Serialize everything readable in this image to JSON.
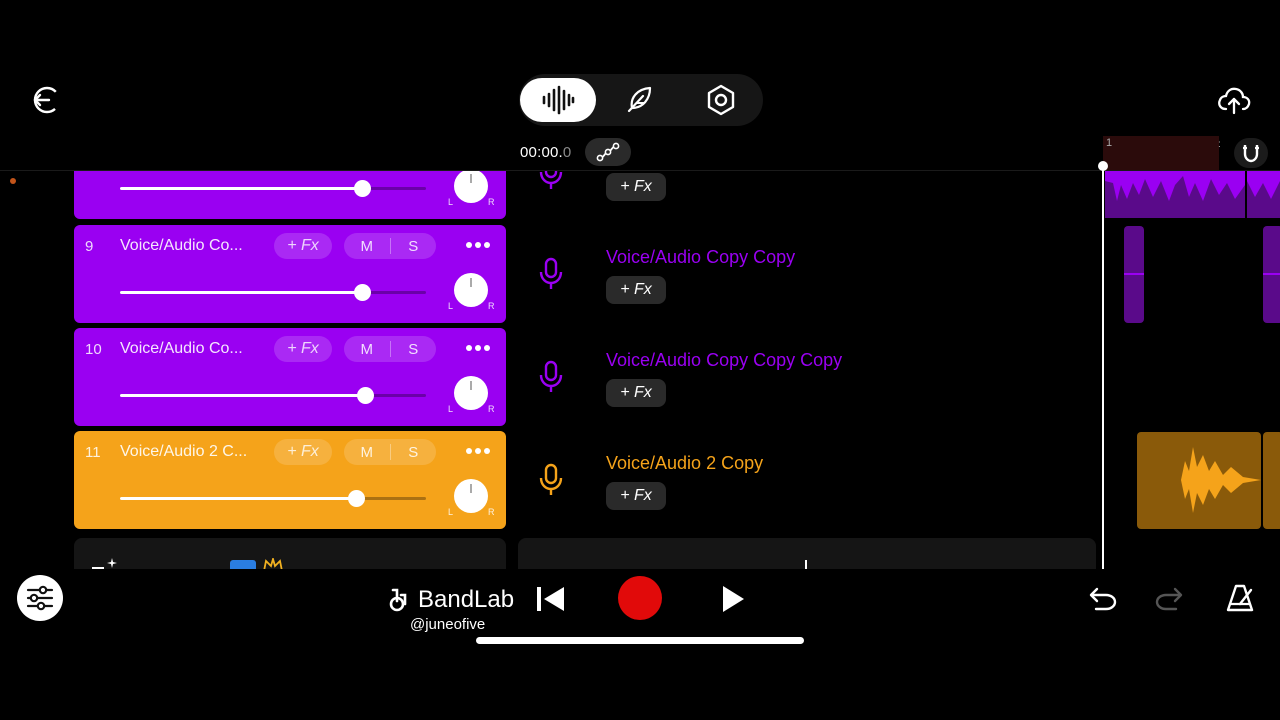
{
  "toolbar": {
    "time_main": "00:00.",
    "time_fraction": "0"
  },
  "ruler": {
    "bar_number": "1"
  },
  "tracks": [
    {
      "num": "",
      "name": "",
      "fx": "+ Fx",
      "mute": "M",
      "solo": "S",
      "volume": 0.79,
      "color": "#9a00f2",
      "pan_l": "L",
      "pan_r": "R",
      "title": "",
      "title_color": "#9a00f2"
    },
    {
      "num": "9",
      "name": "Voice/Audio Co...",
      "fx": "+ Fx",
      "mute": "M",
      "solo": "S",
      "volume": 0.79,
      "color": "#9a00f2",
      "pan_l": "L",
      "pan_r": "R",
      "title": "Voice/Audio Copy Copy",
      "title_color": "#9a00f2"
    },
    {
      "num": "10",
      "name": "Voice/Audio Co...",
      "fx": "+ Fx",
      "mute": "M",
      "solo": "S",
      "volume": 0.8,
      "color": "#9a00f2",
      "pan_l": "L",
      "pan_r": "R",
      "title": "Voice/Audio Copy Copy Copy",
      "title_color": "#9a00f2"
    },
    {
      "num": "11",
      "name": "Voice/Audio 2 C...",
      "fx": "+ Fx",
      "mute": "M",
      "solo": "S",
      "volume": 0.77,
      "color": "#f5a31a",
      "pan_l": "L",
      "pan_r": "R",
      "title": "Voice/Audio 2 Copy",
      "title_color": "#f5a31a"
    }
  ],
  "fx_label": "+ Fx",
  "bottom": {
    "brand": "BandLab",
    "handle": "@juneofive"
  },
  "colors": {
    "accent_purple": "#9a00f2",
    "accent_orange": "#f5a31a",
    "record_red": "#e10a0a"
  },
  "icons": {
    "back": "exit-icon",
    "mode_studio": "waveform-icon",
    "mode_lyrics": "feather-icon",
    "mode_settings": "hexagon-settings-icon",
    "upload": "cloud-upload-icon",
    "magnet": "magnet-icon",
    "mixer": "mixer-sliders-icon",
    "undo": "undo-icon",
    "redo": "redo-icon",
    "metronome": "metronome-icon"
  }
}
